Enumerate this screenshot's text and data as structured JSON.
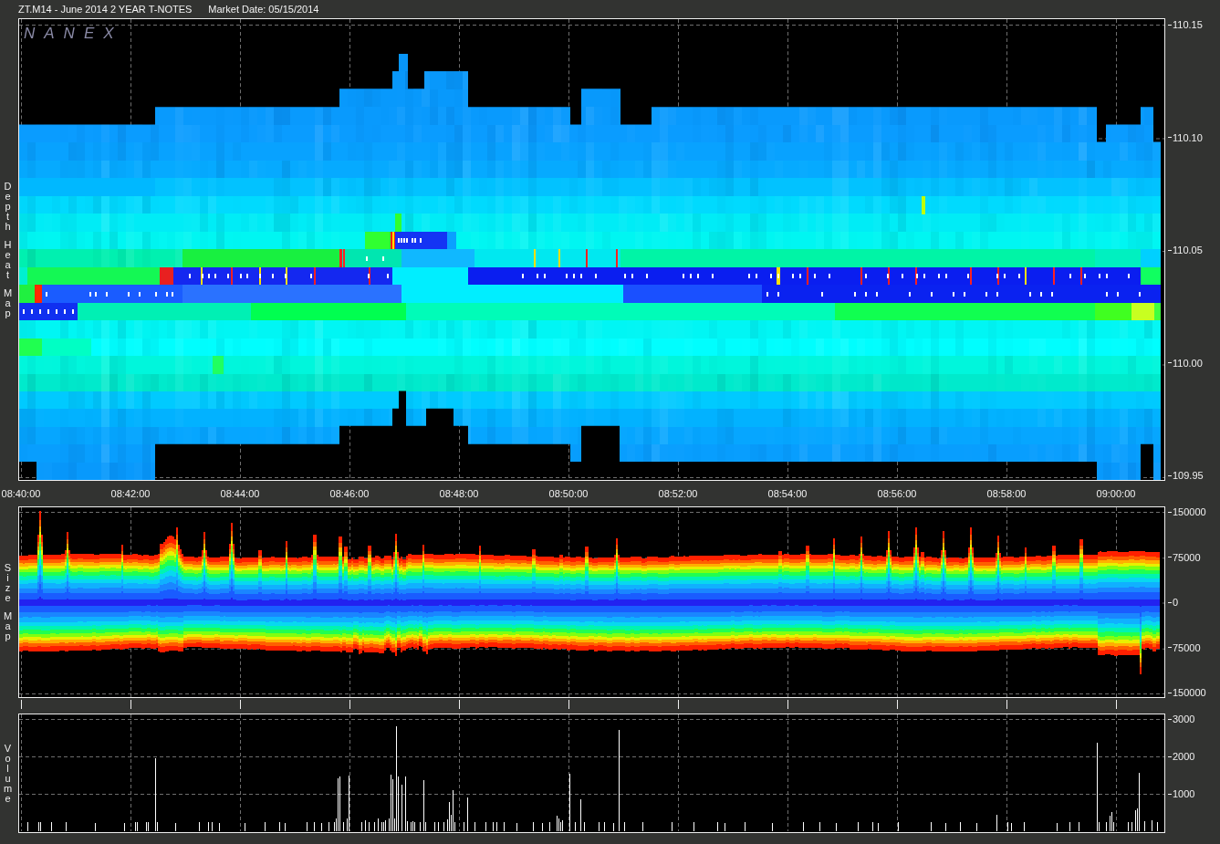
{
  "header": {
    "instrument": "ZT.M14 - June 2014 2 YEAR T-NOTES",
    "market_date": "Market Date: 05/15/2014"
  },
  "depth_heat_map": {
    "side_label": "Depth Heat Map",
    "logo": "NANEX",
    "price_axis": [
      "110.15",
      "110.10",
      "110.05",
      "110.00",
      "109.95"
    ]
  },
  "time_axis": [
    "08:40:00",
    "08:42:00",
    "08:44:00",
    "08:46:00",
    "08:48:00",
    "08:50:00",
    "08:52:00",
    "08:54:00",
    "08:56:00",
    "08:58:00",
    "09:00:00"
  ],
  "size_map": {
    "side_label": "Size Map",
    "size_axis": [
      "150000",
      "75000",
      "0",
      "75000",
      "150000"
    ]
  },
  "volume": {
    "side_label": "Volume",
    "chart_data": {
      "type": "bar",
      "grid": true,
      "categories": [
        null,
        null,
        null,
        null,
        null,
        null,
        null,
        null,
        null,
        null,
        null,
        null,
        null,
        null,
        null,
        null,
        null,
        null,
        null,
        null,
        null,
        null,
        null,
        null,
        null,
        null,
        null,
        null,
        null,
        null,
        null,
        null,
        null,
        null,
        null,
        null,
        null,
        null,
        null,
        null,
        null,
        null,
        null,
        null,
        null,
        null,
        null,
        null,
        null,
        null,
        null,
        null,
        null,
        null,
        null,
        null,
        null,
        null,
        null,
        null,
        null,
        null,
        null,
        null,
        null,
        null,
        null,
        null,
        null,
        null,
        null,
        null,
        null,
        null,
        null,
        null,
        null,
        null,
        null,
        null,
        null,
        null,
        null,
        null,
        null,
        null,
        null,
        null,
        null,
        null,
        null,
        null,
        null,
        null,
        null,
        null,
        null,
        null,
        null,
        null,
        null,
        null,
        null,
        null,
        null,
        null,
        null,
        null,
        null,
        null,
        null,
        null,
        null,
        null,
        null,
        null,
        null,
        null,
        null,
        null,
        null,
        null,
        null,
        null,
        null,
        null,
        null,
        null,
        null,
        null,
        null,
        null,
        null,
        null,
        null,
        null,
        null,
        null,
        null,
        null,
        null,
        null,
        null,
        null,
        null,
        null,
        null,
        null,
        null,
        null,
        null,
        null,
        null,
        null,
        null,
        null,
        null,
        null,
        null,
        null,
        null,
        null,
        null,
        null,
        null,
        null,
        null,
        null,
        null,
        null,
        null,
        null,
        null,
        null,
        null,
        null,
        null,
        null,
        null,
        null,
        null,
        null,
        null,
        null,
        null,
        null,
        null,
        null,
        null,
        null,
        null,
        null,
        null,
        null,
        null,
        null,
        null,
        null,
        null,
        null,
        null,
        null,
        null,
        null,
        null,
        null,
        null,
        null,
        null,
        null,
        null,
        null,
        null,
        null,
        null,
        null,
        null,
        null,
        null,
        null,
        null,
        null,
        null,
        null,
        null,
        null,
        null,
        null,
        null,
        null,
        null,
        null,
        null,
        null,
        null,
        null,
        null,
        null,
        null,
        null,
        null,
        null,
        null,
        null,
        null,
        null,
        null,
        null,
        null,
        null,
        null,
        null,
        null,
        null,
        null,
        null,
        null,
        null,
        null,
        null,
        null,
        null,
        null,
        null,
        null,
        null,
        null,
        null,
        null,
        null,
        null,
        null,
        null,
        null,
        null,
        null,
        null,
        null,
        null,
        null,
        null,
        null,
        null,
        null,
        null,
        null,
        null,
        null,
        null,
        null,
        null,
        null,
        null,
        null,
        null,
        null,
        null,
        null,
        null,
        null,
        null,
        null,
        null,
        null,
        null,
        null,
        null,
        null,
        null,
        null,
        null,
        null,
        null,
        null,
        null,
        null,
        null,
        null,
        null,
        null,
        null,
        null,
        null,
        null,
        null,
        null,
        null,
        null,
        null,
        null,
        null,
        null,
        null,
        null,
        null,
        null,
        null,
        null,
        null,
        null,
        null,
        null,
        null,
        null,
        null,
        null,
        null,
        null,
        null,
        null,
        null,
        null,
        null,
        null,
        null,
        null,
        null,
        null,
        null,
        null,
        null,
        null,
        null,
        null,
        null,
        null,
        null,
        null,
        null,
        null,
        null,
        null,
        null,
        null,
        null,
        null,
        null,
        null,
        null,
        null,
        null,
        null,
        null,
        null,
        null,
        null,
        null,
        null,
        null,
        null,
        null,
        null,
        null,
        null,
        null,
        null,
        null,
        null,
        null,
        null,
        null,
        null,
        null,
        null,
        null,
        null,
        null,
        null,
        null,
        null,
        null,
        null,
        null,
        null,
        null,
        null,
        null,
        null,
        null,
        null,
        null,
        null,
        null,
        null,
        null,
        null,
        null,
        null,
        null,
        null,
        null,
        null,
        null,
        null,
        null,
        null,
        null,
        null,
        null,
        null,
        null,
        null,
        null,
        null,
        null,
        null,
        null,
        null,
        null,
        null,
        null,
        null,
        null,
        null,
        null,
        null,
        null,
        null,
        null,
        null,
        null,
        null,
        null,
        null,
        null,
        null,
        null,
        null,
        null,
        null,
        null,
        null,
        null,
        null,
        null,
        null,
        null,
        null,
        null,
        null,
        null,
        null,
        null,
        null,
        null,
        null,
        null,
        null,
        null,
        null,
        null,
        null,
        null,
        null,
        null,
        null,
        null,
        null,
        null,
        null,
        null,
        null,
        null,
        null,
        null,
        null,
        null,
        null,
        null,
        null,
        null,
        null,
        null,
        null,
        null,
        null,
        null,
        null,
        null,
        null,
        null,
        null,
        null,
        null,
        null,
        null,
        null,
        null,
        null,
        null,
        null,
        null,
        null,
        null,
        null,
        null,
        null,
        null,
        null,
        null,
        null,
        null,
        null,
        null,
        null,
        null,
        null,
        null,
        null,
        null,
        null,
        null,
        null,
        null,
        null,
        null,
        null,
        null,
        null,
        null,
        null,
        null,
        null,
        null,
        null,
        null,
        null,
        null,
        null,
        null,
        null,
        null,
        null,
        null,
        null,
        null,
        null,
        null,
        null,
        null,
        null,
        null,
        null,
        null,
        null,
        null,
        null,
        null,
        null,
        null,
        null,
        null,
        null,
        null,
        null,
        null,
        null,
        null,
        null,
        null,
        null,
        null,
        null,
        null,
        null,
        null,
        null,
        null,
        null,
        null,
        null,
        null,
        null,
        null,
        null,
        null,
        null,
        null,
        null,
        null,
        null,
        null,
        null,
        null,
        null,
        null,
        null
      ],
      "values": [
        null,
        null,
        null,
        null,
        250,
        null,
        null,
        null,
        null,
        null,
        250,
        250,
        null,
        null,
        null,
        null,
        null,
        250,
        null,
        null,
        null,
        null,
        null,
        null,
        null,
        250,
        null,
        null,
        null,
        null,
        null,
        null,
        null,
        null,
        null,
        null,
        null,
        null,
        null,
        null,
        null,
        230,
        null,
        null,
        null,
        null,
        null,
        null,
        null,
        null,
        null,
        null,
        null,
        null,
        null,
        null,
        null,
        230,
        null,
        null,
        null,
        null,
        null,
        250,
        250,
        null,
        null,
        null,
        null,
        250,
        240,
        null,
        null,
        null,
        1950,
        250,
        null,
        null,
        null,
        null,
        null,
        null,
        null,
        null,
        null,
        230,
        null,
        null,
        null,
        null,
        null,
        null,
        null,
        null,
        null,
        null,
        null,
        null,
        250,
        null,
        null,
        null,
        null,
        250,
        null,
        250,
        null,
        null,
        null,
        230,
        null,
        null,
        null,
        null,
        null,
        null,
        null,
        null,
        null,
        null,
        null,
        null,
        null,
        230,
        null,
        null,
        null,
        null,
        null,
        null,
        null,
        null,
        null,
        null,
        250,
        null,
        null,
        null,
        null,
        null,
        null,
        null,
        250,
        null,
        null,
        230,
        null,
        null,
        null,
        null,
        null,
        null,
        null,
        null,
        null,
        null,
        null,
        250,
        null,
        null,
        null,
        250,
        null,
        null,
        null,
        230,
        null,
        null,
        null,
        250,
        null,
        null,
        250,
        350,
        1420,
        1470,
        null,
        250,
        null,
        330,
        1490,
        null,
        null,
        null,
        null,
        null,
        null,
        250,
        null,
        300,
        null,
        250,
        null,
        null,
        250,
        null,
        330,
        null,
        250,
        250,
        300,
        null,
        330,
        1500,
        1380,
        350,
        2800,
        1470,
        null,
        1250,
        null,
        1460,
        260,
        null,
        250,
        270,
        250,
        null,
        null,
        250,
        null,
        1370,
        250,
        null,
        null,
        null,
        null,
        250,
        null,
        250,
        null,
        null,
        250,
        null,
        320,
        780,
        450,
        1100,
        250,
        null,
        null,
        null,
        null,
        250,
        null,
        900,
        null,
        null,
        null,
        250,
        null,
        null,
        null,
        null,
        null,
        250,
        null,
        null,
        null,
        250,
        null,
        250,
        null,
        null,
        null,
        250,
        null,
        null,
        null,
        null,
        null,
        null,
        230,
        null,
        null,
        null,
        null,
        null,
        null,
        null,
        null,
        250,
        null,
        null,
        null,
        null,
        230,
        null,
        null,
        null,
        250,
        null,
        null,
        null,
        420,
        350,
        250,
        300,
        null,
        null,
        null,
        1540,
        null,
        null,
        250,
        null,
        null,
        850,
        null,
        250,
        null,
        null,
        null,
        null,
        null,
        null,
        null,
        250,
        null,
        null,
        250,
        null,
        null,
        null,
        null,
        230,
        null,
        null,
        2700,
        null,
        null,
        250,
        null,
        null,
        null,
        null,
        null,
        null,
        null,
        null,
        null,
        250,
        null,
        null,
        null,
        null,
        null,
        null,
        null,
        null,
        null,
        null,
        null,
        null,
        null,
        null,
        null,
        250,
        null,
        null,
        null,
        null,
        null,
        null,
        null,
        null,
        null,
        null,
        null,
        250,
        null,
        null,
        null,
        null,
        null,
        null,
        null,
        null,
        null,
        null,
        null,
        null,
        250,
        null,
        null,
        null,
        230,
        null,
        null,
        null,
        null,
        null,
        null,
        null,
        null,
        null,
        null,
        250,
        null,
        null,
        null,
        null,
        null,
        null,
        null,
        null,
        null,
        null,
        null,
        null,
        null,
        null,
        230,
        null,
        null,
        null,
        null,
        null,
        null,
        null,
        null,
        null,
        null,
        null,
        null,
        null,
        null,
        null,
        null,
        250,
        null,
        null,
        null,
        null,
        null,
        null,
        null,
        null,
        250,
        null,
        null,
        null,
        null,
        null,
        null,
        null,
        null,
        230,
        null,
        null,
        null,
        null,
        null,
        null,
        null,
        null,
        null,
        null,
        null,
        250,
        null,
        null,
        null,
        null,
        null,
        null,
        null,
        250,
        null,
        null,
        230,
        null,
        null,
        null,
        null,
        null,
        null,
        null,
        null,
        null,
        null,
        250,
        null,
        null,
        null,
        null,
        null,
        null,
        null,
        null,
        null,
        null,
        null,
        null,
        null,
        null,
        null,
        null,
        null,
        250,
        null,
        null,
        null,
        null,
        null,
        null,
        null,
        230,
        null,
        null,
        null,
        null,
        null,
        null,
        null,
        250,
        null,
        null,
        null,
        null,
        null,
        null,
        null,
        null,
        230,
        null,
        null,
        null,
        null,
        null,
        null,
        null,
        null,
        null,
        null,
        430,
        null,
        null,
        null,
        null,
        null,
        250,
        null,
        230,
        null,
        null,
        null,
        null,
        null,
        null,
        250,
        null,
        null,
        null,
        null,
        null,
        null,
        null,
        null,
        null,
        null,
        null,
        null,
        null,
        null,
        null,
        null,
        null,
        230,
        null,
        null,
        null,
        null,
        null,
        null,
        250,
        null,
        null,
        null,
        null,
        250,
        null,
        null,
        null,
        null,
        null,
        null,
        null,
        null,
        null,
        2370,
        250,
        null,
        null,
        null,
        250,
        null,
        420,
        500,
        250,
        null,
        null,
        null,
        null,
        null,
        null,
        null,
        250,
        null,
        250,
        null,
        550,
        600,
        1560,
        null,
        null,
        280,
        null,
        null,
        null,
        300,
        null,
        null,
        250,
        null,
        null,
        null
      ],
      "ylim": [
        0,
        3120
      ],
      "yticks": [
        {
          "value": 3000,
          "label": "3000"
        },
        {
          "value": 2000,
          "label": "2000"
        },
        {
          "value": 1000,
          "label": "1000"
        }
      ]
    }
  }
}
